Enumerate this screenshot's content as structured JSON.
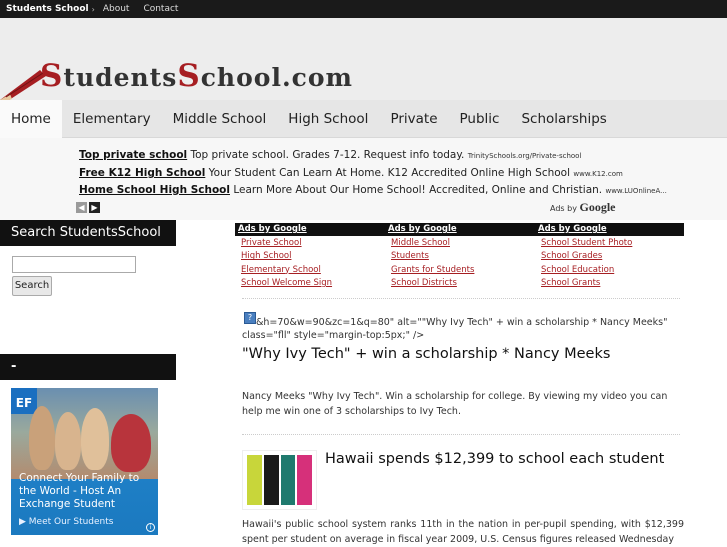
{
  "topbar": {
    "brand": "Students School",
    "arrow": "›",
    "links": [
      "About",
      "Contact"
    ]
  },
  "header": {
    "logo_first": "S",
    "logo_rest1": "tudents",
    "logo_mid": "S",
    "logo_rest2": "chool.com"
  },
  "nav": {
    "items": [
      "Home",
      "Elementary",
      "Middle School",
      "High School",
      "Private",
      "Public",
      "Scholarships"
    ],
    "active": "Home"
  },
  "ad_strip": {
    "ads": [
      {
        "title": "Top private school",
        "text": " Top private school. Grades 7-12. Request info today. ",
        "url": "TrinitySchools.org/Private-school"
      },
      {
        "title": "Free K12 High School",
        "text": " Your Student Can Learn At Home. K12 Accredited Online High School ",
        "url": "www.K12.com"
      },
      {
        "title": "Home School High School",
        "text": " Learn More About Our Home School! Accredited, Online and Christian. ",
        "url": "www.LUOnlineA..."
      }
    ],
    "ads_by": "Ads by",
    "google": "Google"
  },
  "sidebar": {
    "search_heading": "Search StudentsSchool",
    "search_button": "Search",
    "second_heading": "-",
    "ef_ad": {
      "logo": "EF",
      "text": "Connect Your Family to the World - Host An Exchange Student",
      "link": "▶ Meet Our Students",
      "info": "i"
    }
  },
  "ad_columns": [
    {
      "header": "Ads by Google",
      "links": [
        "Private School",
        "High School",
        "Elementary School",
        "School Welcome Sign"
      ]
    },
    {
      "header": "Ads by Google",
      "links": [
        "Middle School",
        "Students",
        "Grants for Students",
        "School Districts"
      ]
    },
    {
      "header": "Ads by Google",
      "links": [
        "School Student Photo",
        "School Grades",
        "School Education",
        "School Grants"
      ]
    }
  ],
  "posts": [
    {
      "code_snippet": "&h=70&w=90&zc=1&q=80\" alt=\"\"Why Ivy Tech\" + win a scholarship * Nancy Meeks\" class=\"fll\" style=\"margin-top:5px;\" />",
      "title": "\"Why Ivy Tech\" + win a scholarship * Nancy Meeks",
      "body": "Nancy Meeks \"Why Ivy Tech\". Win a scholarship for college. By viewing my video you can help me win one of 3 scholarships to Ivy Tech."
    },
    {
      "title": "Hawaii spends $12,399 to school each student",
      "body": "Hawaii's public school system ranks 11th in the nation in per-pupil spending, with $12,399 spent per student on average in fiscal year 2009, U.S. Census figures released Wednesday",
      "thumb_colors": [
        "#c8d63a",
        "#1a1a1a",
        "#1f7a6e",
        "#d6307a"
      ]
    }
  ],
  "colors": {
    "accent_red": "#a61e22",
    "topbar": "#1a1a1a",
    "nav_bg": "#e6e6e6"
  }
}
